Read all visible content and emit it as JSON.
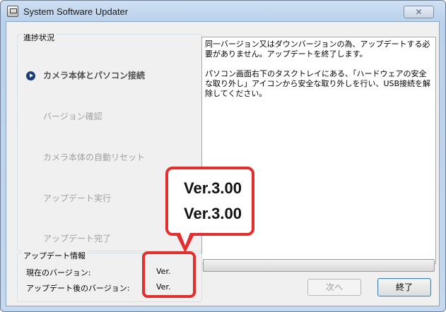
{
  "window": {
    "title": "System Software Updater",
    "close_glyph": "✕"
  },
  "progress": {
    "title": "進捗状況",
    "steps": [
      {
        "label": "カメラ本体とパソコン接続",
        "active": true
      },
      {
        "label": "バージョン確認",
        "active": false
      },
      {
        "label": "カメラ本体の自動リセット",
        "active": false
      },
      {
        "label": "アップデート実行",
        "active": false
      },
      {
        "label": "アップデート完了",
        "active": false
      }
    ]
  },
  "message": {
    "paragraphs": [
      "同一バージョン又はダウンバージョンの為、アップデートする必要がありません。アップデートを終了します。",
      "パソコン画面右下のタスクトレイにある、「ハードウェアの安全な取り外し」アイコンから安全な取り外しを行い、USB接続を解除してください。"
    ]
  },
  "update_info": {
    "title": "アップデート情報",
    "current_label": "現在のバージョン:",
    "current_value": "Ver.",
    "after_label": "アップデート後のバージョン:",
    "after_value": "Ver."
  },
  "progress_bar": {
    "fraction": 0.0
  },
  "buttons": {
    "next": "次へ",
    "exit": "終了"
  },
  "callout": {
    "line1": "Ver.3.00",
    "line2": "Ver.3.00"
  },
  "colors": {
    "callout_accent": "#e52d2d",
    "step_active_icon": "#1a3a7a"
  },
  "icons": {
    "app": "updater-app-icon",
    "close": "close-icon",
    "step_pointer": "play-arrow-icon"
  }
}
